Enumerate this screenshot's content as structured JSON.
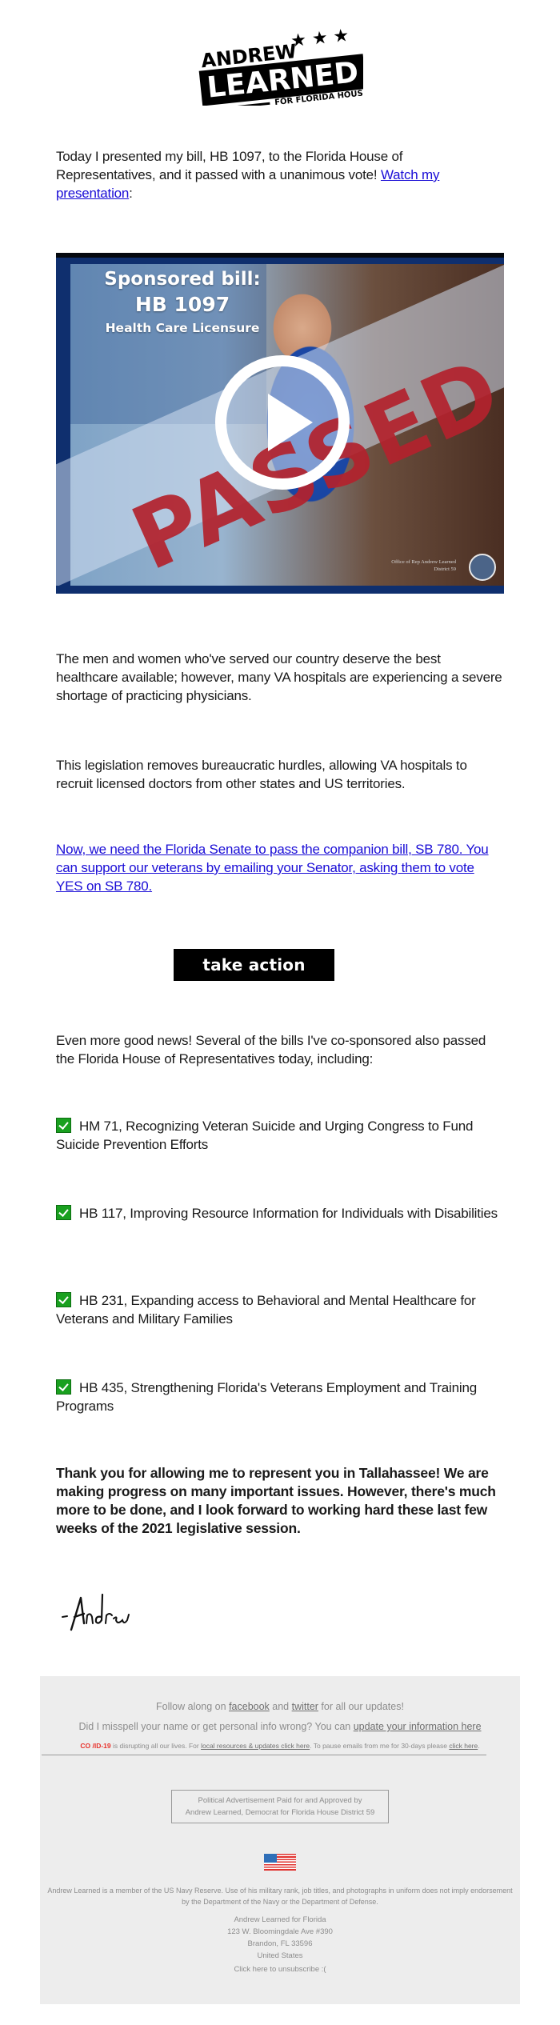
{
  "header": {
    "logo": {
      "first_name": "ANDREW",
      "last_name": "LEARNED",
      "tagline": "FOR FLORIDA HOUSE",
      "stars": "★ ★ ★"
    }
  },
  "intro": {
    "text": "Today I presented my bill, HB 1097, to the Florida House of Representatives, and it passed with a unanimous vote! ",
    "link_label": "Watch my presentation",
    "suffix": ":"
  },
  "video": {
    "title_line1": "Sponsored  bill:",
    "title_line2": "HB 1097",
    "title_line3": "Health Care Licensure",
    "stamp": "PASSED",
    "credit_line1": "Office of Rep Andrew Learned",
    "credit_line2": "District 59"
  },
  "body": {
    "paragraph1": "The men and women who've served our country deserve the best healthcare available; however, many VA hospitals are experiencing a severe shortage of practicing physicians.",
    "paragraph2": "This legislation removes bureaucratic hurdles, allowing VA hospitals to recruit licensed doctors from other states and US territories.",
    "senate_link": "Now, we need the Florida Senate to pass the companion bill, SB 780. You can support our veterans by emailing your Senator, asking them to vote YES on SB 780.",
    "cta_label": "take action",
    "cosponsored_intro": "Even more good news! Several of the bills I've co-sponsored also passed the Florida House of Representatives today, including:",
    "bills": [
      {
        "text": "HM 71, Recognizing Veteran Suicide and Urging Congress to Fund Suicide Prevention Efforts"
      },
      {
        "text": "HB 117, Improving Resource Information for Individuals with Disabilities"
      },
      {
        "text": "HB 231, Expanding access to Behavioral and Mental Healthcare for Veterans and Military Families"
      },
      {
        "text": "HB 435, Strengthening Florida's Veterans Employment and Training Programs"
      }
    ],
    "closing": "Thank you for allowing me to represent you in Tallahassee! We are making progress on many important issues. However, there's much more to be done, and I look forward to working hard these last few weeks of the 2021 legislative session.",
    "signature": "-Andrew"
  },
  "footer": {
    "follow_prefix": "Follow along on ",
    "facebook": "facebook",
    "follow_and": " and ",
    "twitter": "twitter",
    "follow_suffix": " for all our updates!",
    "misspell_prefix": "Did I misspell your name or get personal info wrong? You can ",
    "update_link": "update your information here",
    "covid_label": "CO /ID-19",
    "covid_text": " is disrupting all our lives. For ",
    "covid_link": "local resources & updates click here",
    "covid_pause": ". To pause emails from me for 30-days please ",
    "pause_link": "click here",
    "covid_end": ".",
    "disclaimer_line1": "Political Advertisement Paid for and Approved by",
    "disclaimer_line2": "Andrew Learned, Democrat for Florida House District 59",
    "navy_notice": "Andrew Learned is a member of the US Navy Reserve. Use of his military rank, job titles, and photographs in uniform does not imply endorsement by the Department of the Navy or the Department of Defense.",
    "address": {
      "org": "Andrew Learned for Florida",
      "street": "123 W. Bloomingdale Ave #390",
      "city": "Brandon, FL 33596",
      "country": "United States"
    },
    "unsubscribe": "Click here to unsubscribe :("
  },
  "colors": {
    "link": "#1a0dd6",
    "cta_bg": "#000000",
    "check_green": "#19a01f",
    "covid_red": "#e8322b",
    "footer_bg": "#ededed",
    "passed_red": "#b3222d",
    "video_navy": "#0f2f6e"
  }
}
